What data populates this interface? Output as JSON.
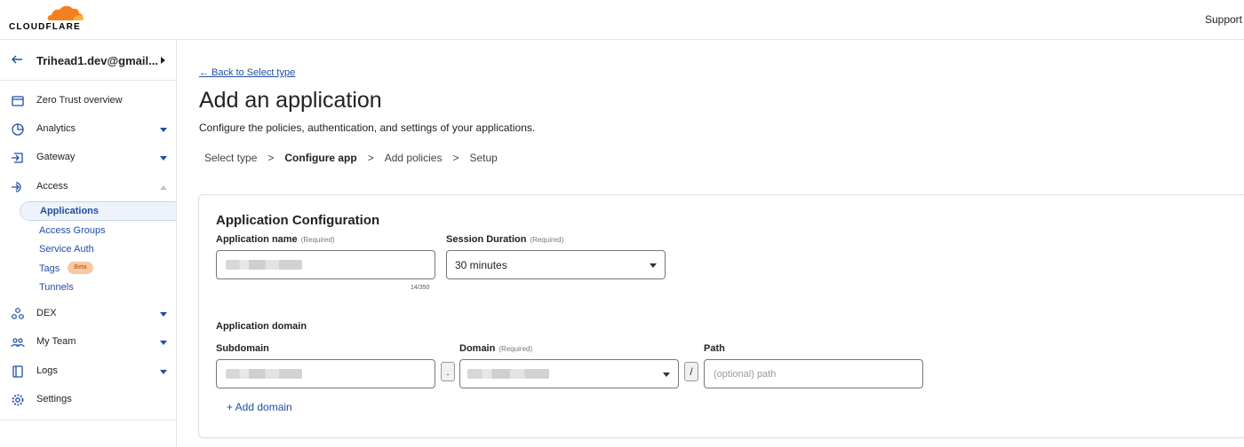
{
  "brand": {
    "name": "CLOUDFLARE",
    "logo_color": "#f38020"
  },
  "header": {
    "support_label": "Support"
  },
  "sidebar": {
    "account_name": "Trihead1.dev@gmail...",
    "items": [
      {
        "label": "Zero Trust overview",
        "icon": "dashboard-icon"
      },
      {
        "label": "Analytics",
        "icon": "pie-chart-icon"
      },
      {
        "label": "Gateway",
        "icon": "gateway-icon"
      },
      {
        "label": "Access",
        "icon": "access-icon"
      },
      {
        "label": "DEX",
        "icon": "dex-icon"
      },
      {
        "label": "My Team",
        "icon": "team-icon"
      },
      {
        "label": "Logs",
        "icon": "logs-icon"
      },
      {
        "label": "Settings",
        "icon": "gear-icon"
      }
    ],
    "access_sub": [
      {
        "label": "Applications"
      },
      {
        "label": "Access Groups"
      },
      {
        "label": "Service Auth"
      },
      {
        "label": "Tags"
      },
      {
        "label": "Tunnels"
      }
    ],
    "tags_badge": "Beta"
  },
  "main": {
    "back_link": "← Back to Select type",
    "title": "Add an application",
    "description": "Configure the policies, authentication, and settings of your applications.",
    "steps": [
      "Select type",
      "Configure app",
      "Add policies",
      "Setup"
    ],
    "step_separator": ">",
    "current_step": "Configure app"
  },
  "form": {
    "card_title": "Application Configuration",
    "app_name_label": "Application name",
    "required_text": "(Required)",
    "app_name_counter": "14/350",
    "session_label": "Session Duration",
    "session_value": "30 minutes",
    "app_domain_label": "Application domain",
    "subdomain_label": "Subdomain",
    "domain_label": "Domain",
    "path_label": "Path",
    "dot_separator": ".",
    "slash_separator": "/",
    "path_placeholder": "(optional) path",
    "add_domain_label": "+ Add domain"
  }
}
